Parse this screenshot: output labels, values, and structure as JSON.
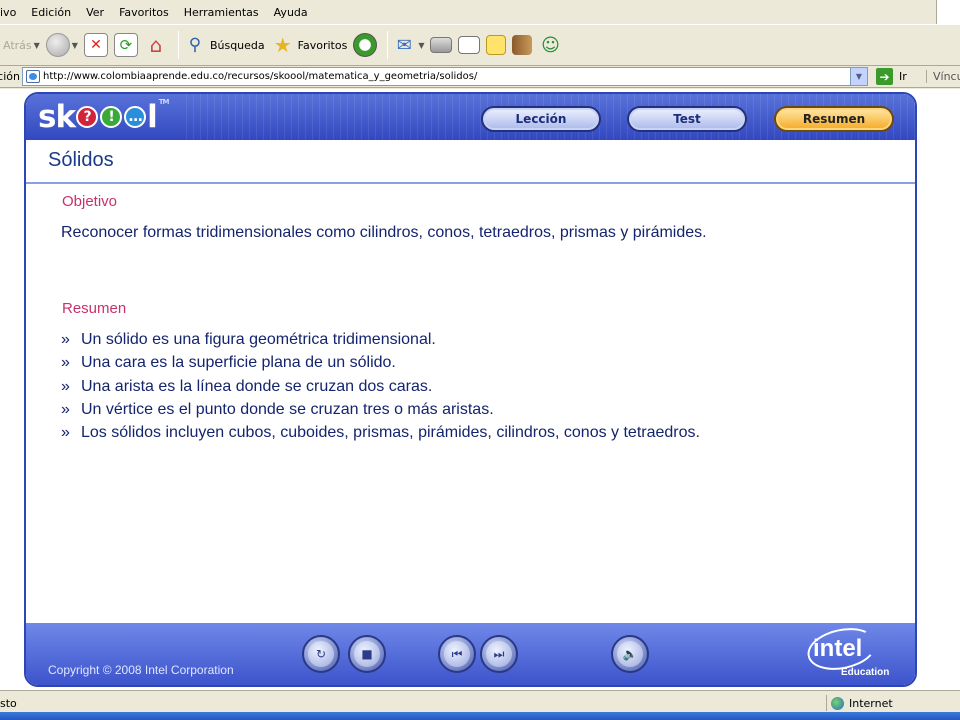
{
  "menu": [
    "ivo",
    "Edición",
    "Ver",
    "Favoritos",
    "Herramientas",
    "Ayuda"
  ],
  "toolbar": {
    "back_label": "Atrás",
    "search_label": "Búsqueda",
    "favorites_label": "Favoritos"
  },
  "address": {
    "label": "Dirección",
    "url": "http://www.colombiaaprende.edu.co/recursos/skoool/matematica_y_geometria/solidos/",
    "go_label": "Ir",
    "links_label": "Víncul"
  },
  "skoool": {
    "logo": "sk",
    "logo_balls": [
      "?",
      "!",
      "…"
    ],
    "logo_end": "l",
    "tm": "TM",
    "tabs": [
      "Lección",
      "Test",
      "Resumen"
    ],
    "active_tab": "Resumen",
    "page_title": "Sólidos",
    "objective_heading": "Objetivo",
    "objective_text": "Reconocer formas tridimensionales como cilindros, conos, tetraedros, prismas y pirámides.",
    "summary_heading": "Resumen",
    "bullet_mark": "»",
    "bullets": [
      "Un sólido es una figura geométrica tridimensional.",
      "Una cara es la superficie plana de un sólido.",
      "Una arista es la línea donde se cruzan dos caras.",
      "Un vértice es el punto donde se cruzan tres o más aristas.",
      "Los sólidos incluyen cubos, cuboides, prismas, pirámides, cilindros, conos y tetraedros."
    ],
    "copyright": "Copyright © 2008 Intel Corporation",
    "intel_word": "intel",
    "intel_edu": "Education"
  },
  "status": {
    "left": "sto",
    "zone": "Internet"
  },
  "colors": {
    "frame_blue": "#2d45b5",
    "heading_pink": "#c8326c",
    "body_navy": "#14246e",
    "active_tab": "#f5a823"
  }
}
